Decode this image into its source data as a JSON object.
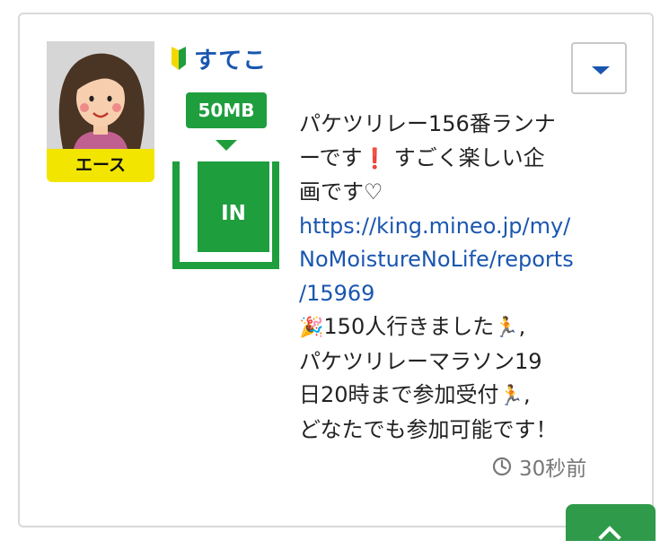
{
  "user": {
    "name": "すてこ",
    "rank": "エース"
  },
  "packet": {
    "amount": "50MB",
    "direction": "IN"
  },
  "post": {
    "line1": "パケツリレー156番ランナ",
    "line2a": "ーです",
    "line2_icon": "❗",
    "line2b": " すごく楽しい企",
    "line3": "画です♡",
    "link": "https://king.mineo.jp/my/NoMoistureNoLife/reports/15969",
    "link_line1": "https://king.mineo.jp/my/",
    "link_line2": "NoMoistureNoLife/reports",
    "link_line3": "/15969",
    "party_icon": "🎉",
    "line7": "150人行きました",
    "runner_icon": "🏃",
    "line7_end": ",",
    "line8": "パケツリレーマラソン19",
    "line9": "日20時まで参加受付",
    "line9_end": ",",
    "line10": "どなたでも参加可能です！"
  },
  "timestamp": "30秒前",
  "icons": {
    "menu": "chevron-down-icon",
    "beginner": "beginner-mark-icon",
    "clock": "clock-icon",
    "scroll": "chevron-up-icon"
  },
  "colors": {
    "accent_blue": "#1a56b0",
    "green": "#1f9e3e",
    "rank_yellow": "#f2e600"
  }
}
